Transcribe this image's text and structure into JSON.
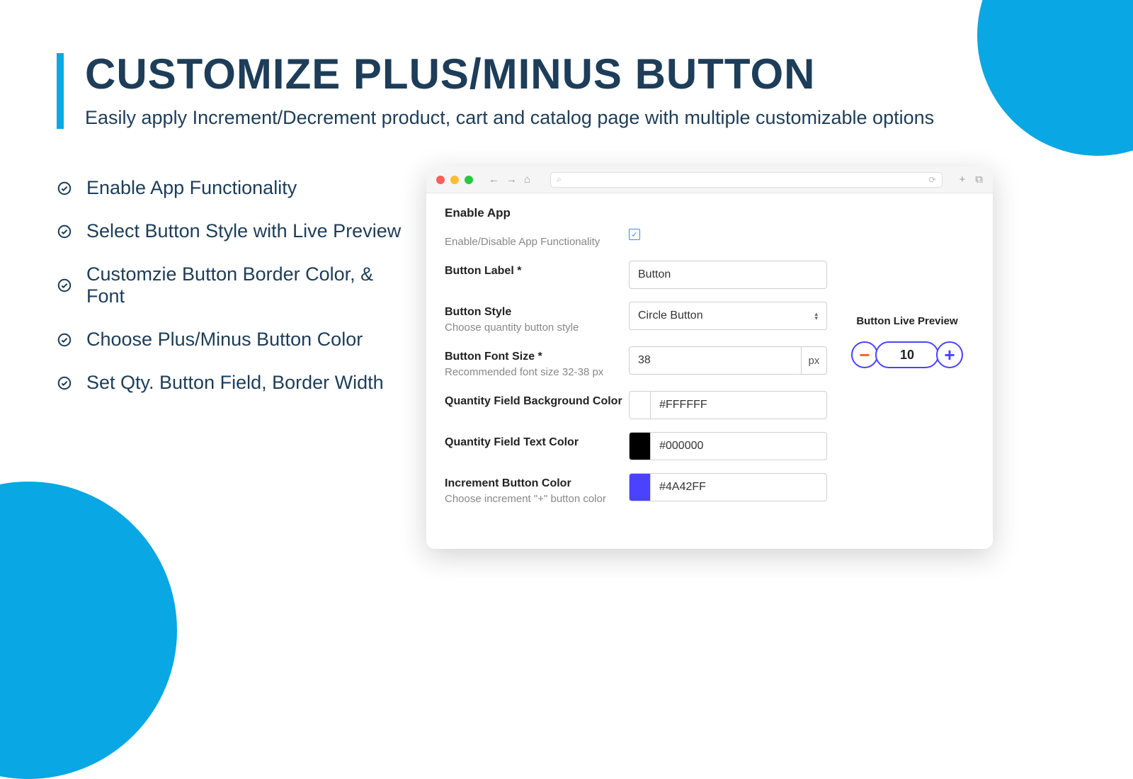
{
  "header": {
    "title": "CUSTOMIZE PLUS/MINUS BUTTON",
    "subtitle": "Easily apply Increment/Decrement product, cart and catalog page with multiple customizable options"
  },
  "features": [
    "Enable App Functionality",
    "Select Button Style with Live Preview",
    "Customzie Button Border Color, & Font",
    "Choose Plus/Minus Button Color",
    "Set Qty. Button Field, Border Width"
  ],
  "app": {
    "section_enable": "Enable App",
    "enable_hint": "Enable/Disable App Functionality",
    "enable_checked": true,
    "button_label": {
      "label": "Button Label",
      "required": "*",
      "value": "Button"
    },
    "button_style": {
      "label": "Button Style",
      "hint": "Choose quantity button style",
      "value": "Circle Button"
    },
    "font_size": {
      "label": "Button Font Size",
      "required": "*",
      "value": "38",
      "unit": "px",
      "hint": "Recommended font size 32-38 px"
    },
    "bg_color": {
      "label": "Quantity Field Background Color",
      "value": "#FFFFFF"
    },
    "text_color": {
      "label": "Quantity Field Text Color",
      "value": "#000000"
    },
    "inc_color": {
      "label": "Increment Button Color",
      "hint": "Choose increment \"+\" button color",
      "value": "#4A42FF"
    },
    "preview": {
      "title": "Button Live Preview",
      "quantity": "10"
    }
  }
}
